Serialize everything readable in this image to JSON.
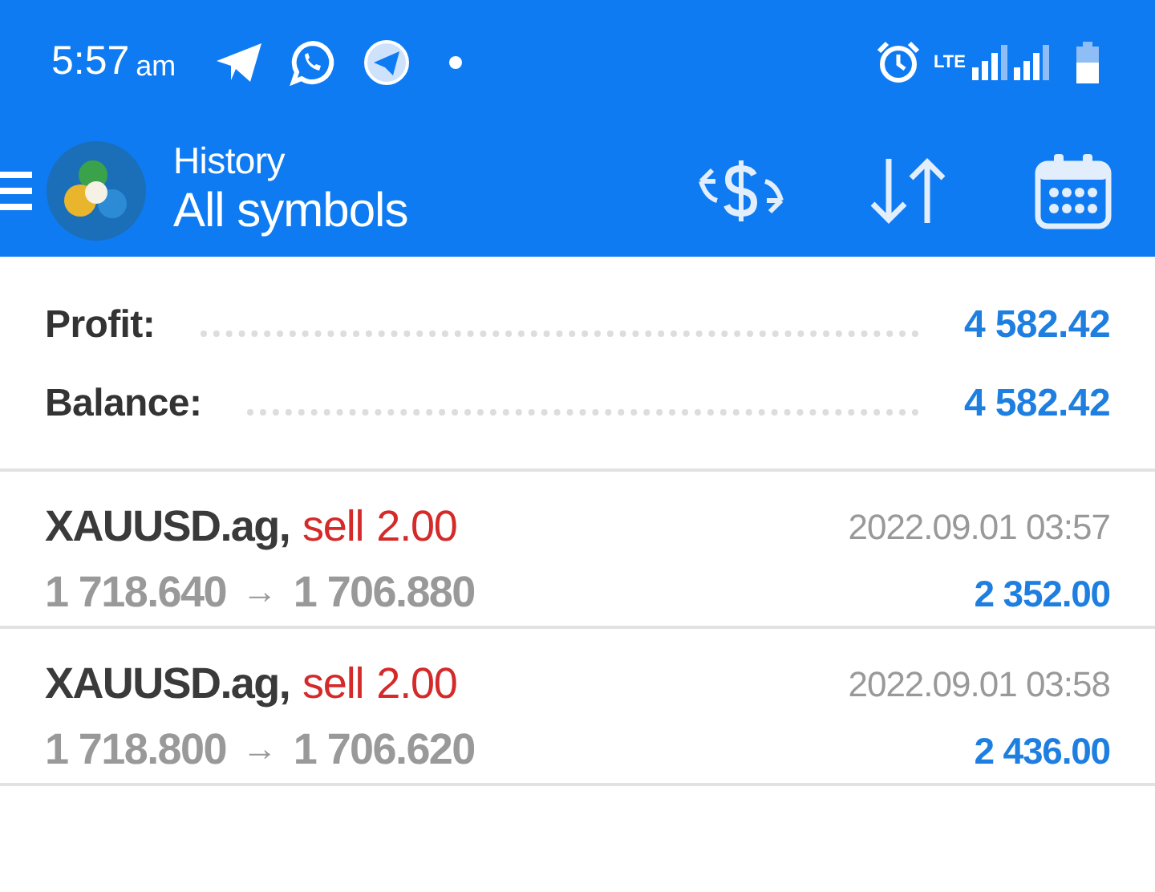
{
  "status_bar": {
    "time": "5:57",
    "ampm": "am",
    "network": "LTE"
  },
  "header": {
    "subtitle": "History",
    "title": "All symbols"
  },
  "summary": [
    {
      "label": "Profit:",
      "value": "4 582.42"
    },
    {
      "label": "Balance:",
      "value": "4 582.42"
    }
  ],
  "deals": [
    {
      "symbol": "XAUUSD.ag,",
      "type": "sell",
      "volume": "2.00",
      "open_price": "1 718.640",
      "arrow": "→",
      "close_price": "1 706.880",
      "time": "2022.09.01 03:57",
      "profit": "2 352.00"
    },
    {
      "symbol": "XAUUSD.ag,",
      "type": "sell",
      "volume": "2.00",
      "open_price": "1 718.800",
      "arrow": "→",
      "close_price": "1 706.620",
      "time": "2022.09.01 03:58",
      "profit": "2 436.00"
    }
  ]
}
